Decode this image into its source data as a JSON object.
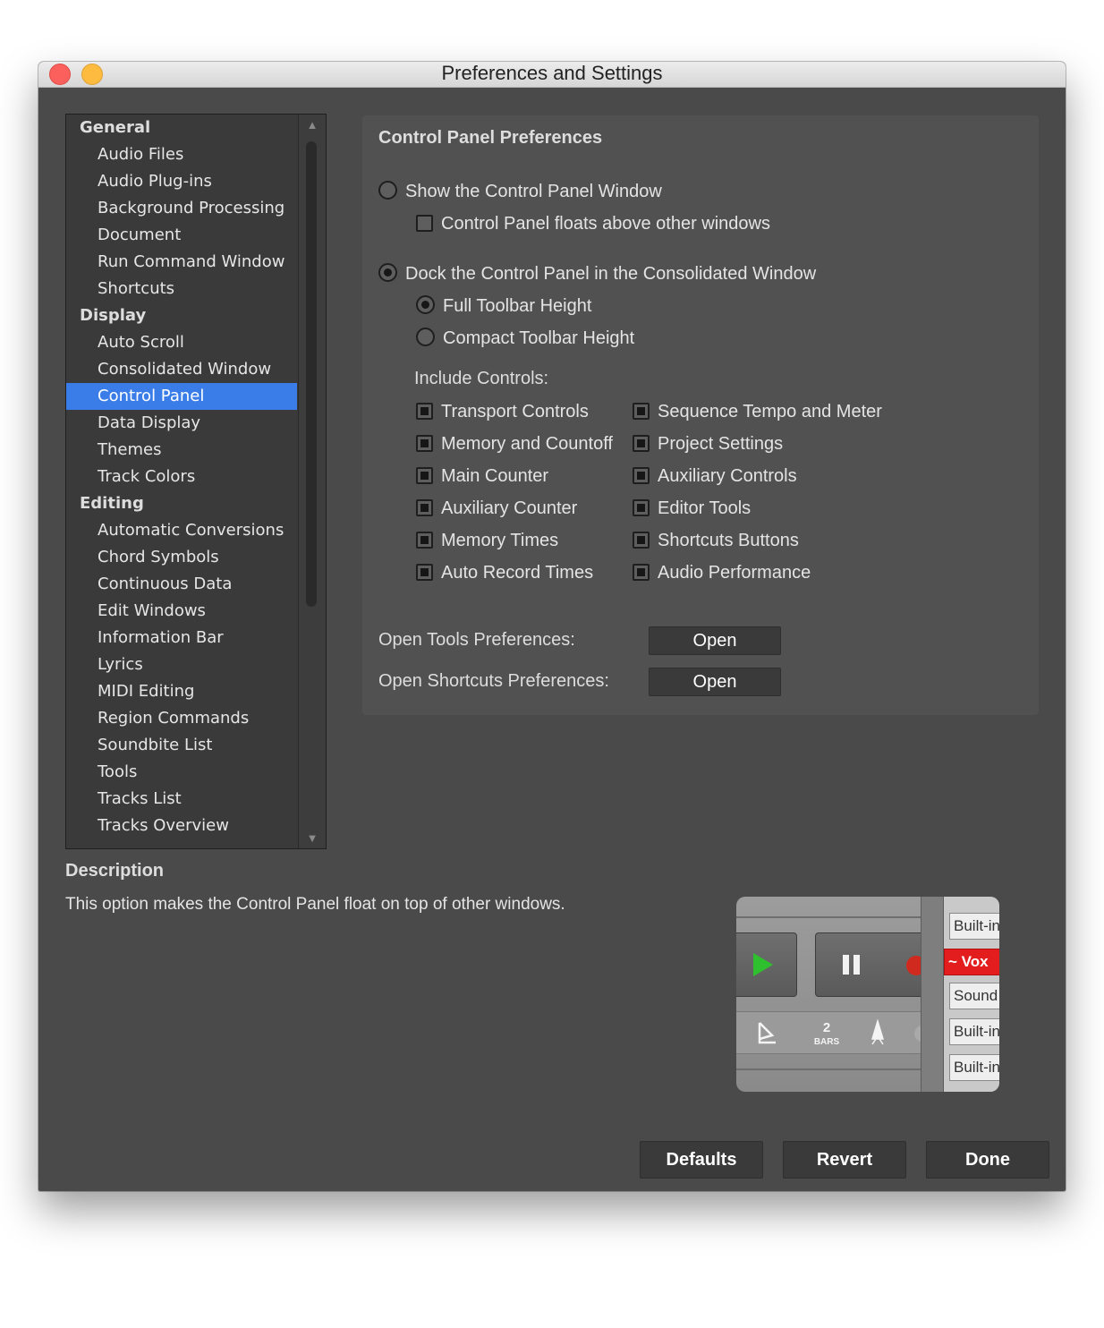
{
  "window": {
    "title": "Preferences and Settings"
  },
  "sidebar": {
    "items": [
      {
        "label": "General",
        "category": true
      },
      {
        "label": "Audio Files"
      },
      {
        "label": "Audio Plug-ins"
      },
      {
        "label": "Background Processing"
      },
      {
        "label": "Document"
      },
      {
        "label": "Run Command Window"
      },
      {
        "label": "Shortcuts"
      },
      {
        "label": "Display",
        "category": true
      },
      {
        "label": "Auto Scroll"
      },
      {
        "label": "Consolidated Window"
      },
      {
        "label": "Control Panel",
        "selected": true
      },
      {
        "label": "Data Display"
      },
      {
        "label": "Themes"
      },
      {
        "label": "Track Colors"
      },
      {
        "label": "Editing",
        "category": true
      },
      {
        "label": "Automatic Conversions"
      },
      {
        "label": "Chord Symbols"
      },
      {
        "label": "Continuous Data"
      },
      {
        "label": "Edit Windows"
      },
      {
        "label": "Information Bar"
      },
      {
        "label": "Lyrics"
      },
      {
        "label": "MIDI Editing"
      },
      {
        "label": "Region Commands"
      },
      {
        "label": "Soundbite List"
      },
      {
        "label": "Tools"
      },
      {
        "label": "Tracks List"
      },
      {
        "label": "Tracks Overview"
      }
    ],
    "selected_color": "#3a7de9"
  },
  "panel": {
    "title": "Control Panel Preferences",
    "show_window": {
      "label": "Show the Control Panel Window",
      "selected": false
    },
    "floats": {
      "label": "Control Panel floats above other windows",
      "checked": false
    },
    "dock": {
      "label": "Dock the Control Panel in the Consolidated Window",
      "selected": true
    },
    "full_height": {
      "label": "Full Toolbar Height",
      "selected": true
    },
    "compact_height": {
      "label": "Compact Toolbar Height",
      "selected": false
    },
    "include_label": "Include Controls:",
    "controls_left": [
      {
        "label": "Transport Controls",
        "checked": true
      },
      {
        "label": "Memory and Countoff",
        "checked": true
      },
      {
        "label": "Main Counter",
        "checked": true
      },
      {
        "label": "Auxiliary Counter",
        "checked": true
      },
      {
        "label": "Memory Times",
        "checked": true
      },
      {
        "label": "Auto Record Times",
        "checked": true
      }
    ],
    "controls_right": [
      {
        "label": "Sequence Tempo and Meter",
        "checked": true
      },
      {
        "label": "Project Settings",
        "checked": true
      },
      {
        "label": "Auxiliary Controls",
        "checked": true
      },
      {
        "label": "Editor Tools",
        "checked": true
      },
      {
        "label": "Shortcuts Buttons",
        "checked": true
      },
      {
        "label": "Audio Performance",
        "checked": true
      }
    ],
    "tools_prefs": {
      "label": "Open Tools Preferences:",
      "button": "Open"
    },
    "shortcuts_prefs": {
      "label": "Open Shortcuts Preferences:",
      "button": "Open"
    }
  },
  "description": {
    "title": "Description",
    "text": "This option makes the Control Panel float on top of other windows."
  },
  "preview": {
    "bars_number": "2",
    "bars_label": "BARS",
    "entries": [
      "Built-in",
      "~ Vox",
      "Sound",
      "Built-in",
      "Built-in"
    ],
    "play_color": "#2fc02f",
    "record_color": "#d02a1e"
  },
  "footer": {
    "defaults": "Defaults",
    "revert": "Revert",
    "done": "Done"
  }
}
